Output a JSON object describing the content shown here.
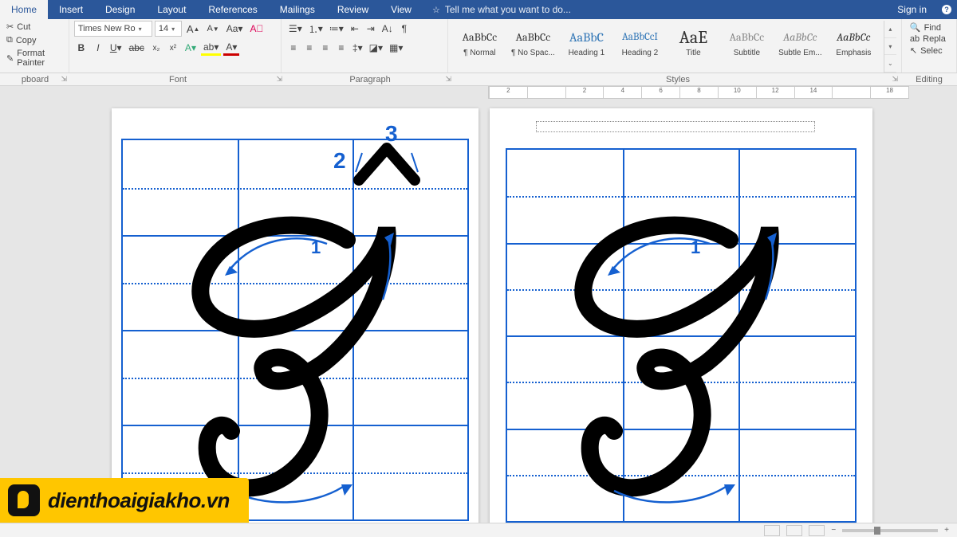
{
  "tabs": {
    "items": [
      "Home",
      "Insert",
      "Design",
      "Layout",
      "References",
      "Mailings",
      "Review",
      "View"
    ],
    "active": "Home",
    "tellme": "Tell me what you want to do...",
    "signin": "Sign in"
  },
  "clipboard": {
    "cut": "Cut",
    "copy": "Copy",
    "format_painter": "Format Painter",
    "label": "pboard"
  },
  "font": {
    "name": "Times New Ro",
    "size": "14",
    "label": "Font"
  },
  "paragraph": {
    "label": "Paragraph"
  },
  "styles": {
    "label": "Styles",
    "items": [
      {
        "preview": "AaBbCc",
        "name": "¶ Normal",
        "sel": true
      },
      {
        "preview": "AaBbCc",
        "name": "¶ No Spac..."
      },
      {
        "preview": "AaBbC",
        "name": "Heading 1",
        "color": "#2e74b5",
        "size": "16px"
      },
      {
        "preview": "AaBbCcI",
        "name": "Heading 2",
        "color": "#2e74b5",
        "size": "13px"
      },
      {
        "preview": "AaE",
        "name": "Title",
        "size": "22px"
      },
      {
        "preview": "AaBbCc",
        "name": "Subtitle",
        "color": "#888"
      },
      {
        "preview": "AaBbCc",
        "name": "Subtle Em...",
        "italic": true,
        "color": "#888"
      },
      {
        "preview": "AaBbCc",
        "name": "Emphasis",
        "italic": true
      }
    ]
  },
  "editing": {
    "find": "Find",
    "replace": "Repla",
    "select": "Selec",
    "label": "Editing"
  },
  "ruler": {
    "marks": [
      "2",
      "",
      "2",
      "4",
      "6",
      "8",
      "10",
      "12",
      "14",
      "",
      "18"
    ]
  },
  "document": {
    "left_strokes": {
      "s1": "1",
      "s2": "2",
      "s3": "3"
    },
    "right_strokes": {
      "s1": "1"
    }
  },
  "watermark": "dienthoaigiakho.vn"
}
